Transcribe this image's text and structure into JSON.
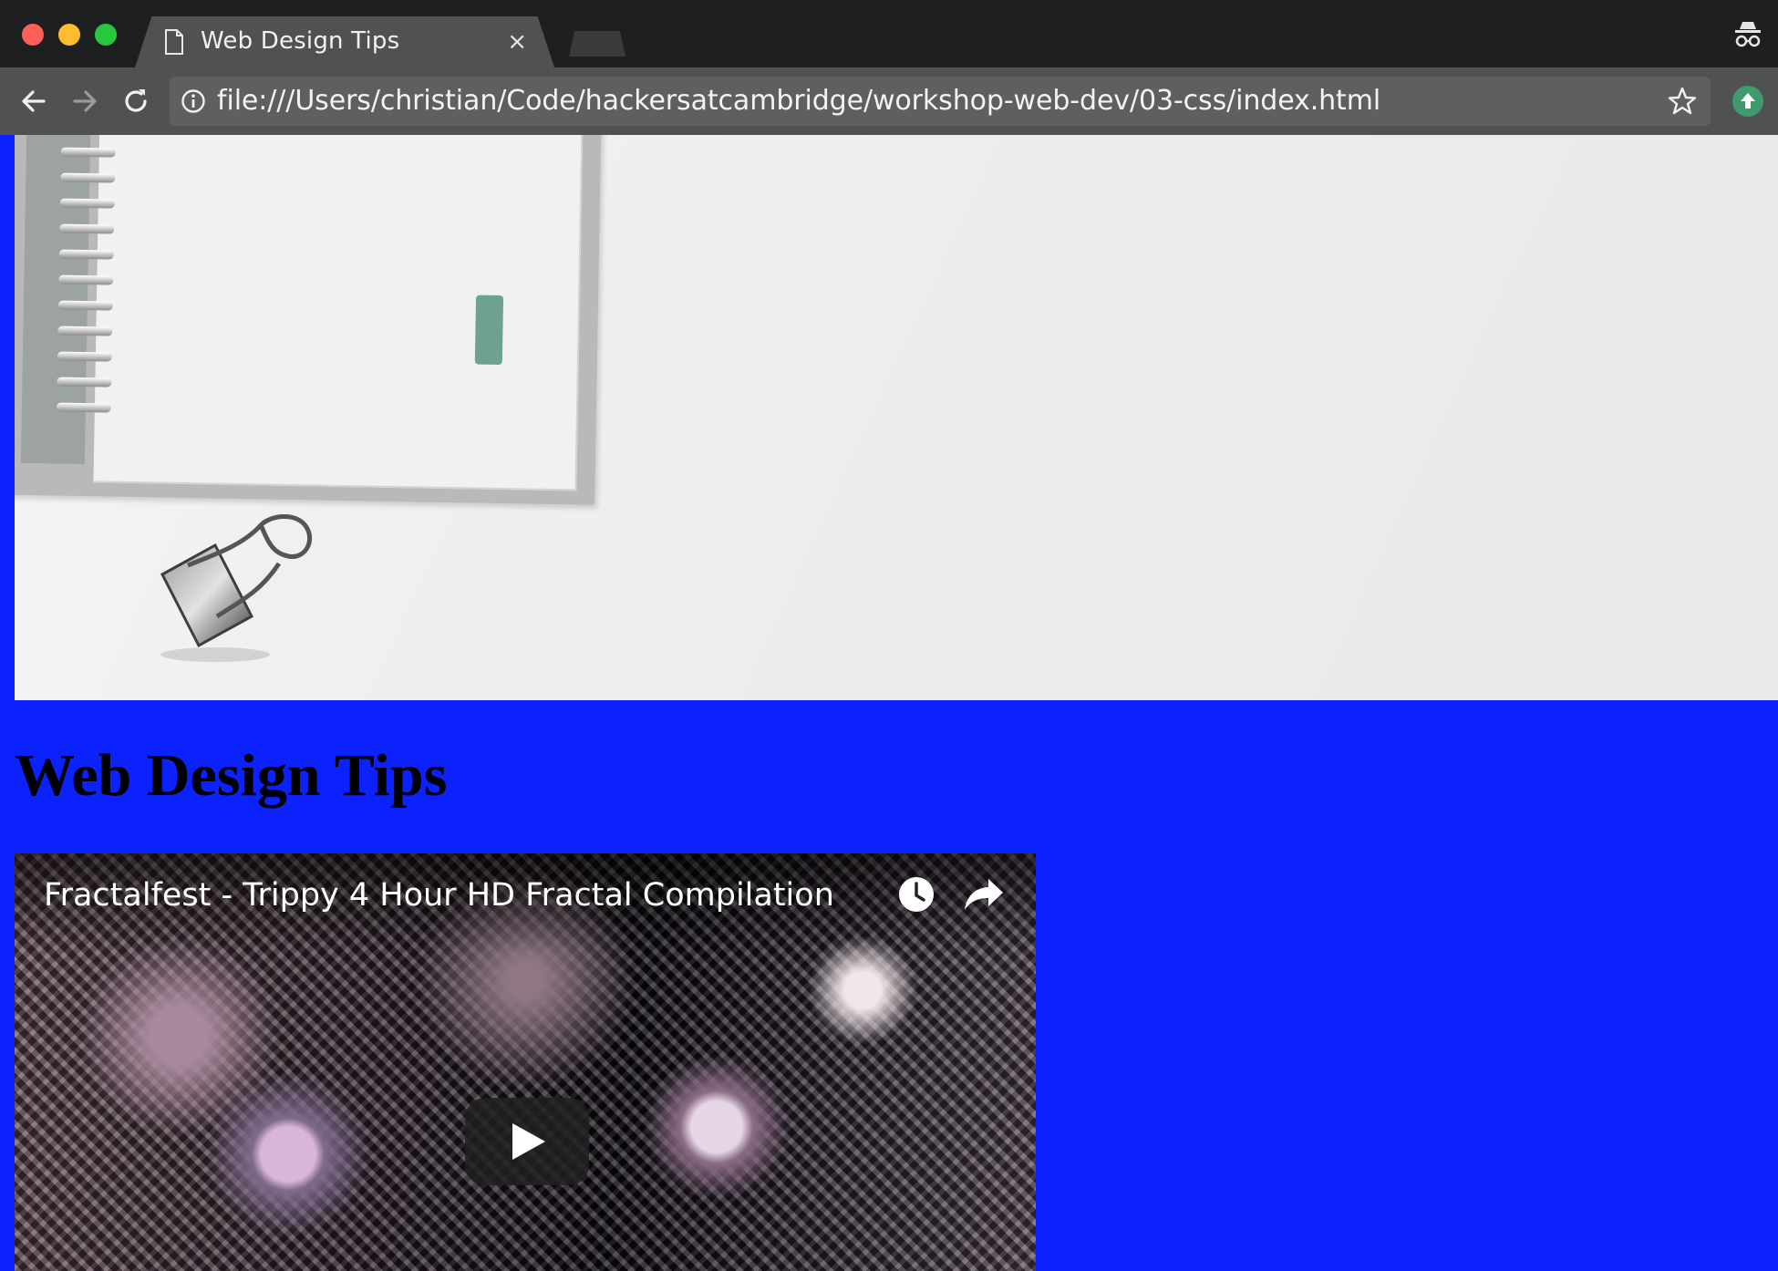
{
  "browser": {
    "tab": {
      "title": "Web Design Tips",
      "close_label": "×"
    },
    "address_bar": {
      "url": "file:///Users/christian/Code/hackersatcambridge/workshop-web-dev/03-css/index.html"
    },
    "icons": {
      "tab": "page-icon",
      "back": "back-arrow-icon",
      "forward": "forward-arrow-icon",
      "reload": "reload-icon",
      "info": "info-icon",
      "bookmark": "star-icon",
      "extension": "extension-icon",
      "incognito": "incognito-icon"
    }
  },
  "page": {
    "background_color": "#0c22fd",
    "heading": "Web Design Tips",
    "hero_image": "desk-notebook-binder-clip-photo",
    "video": {
      "title": "Fractalfest - Trippy 4 Hour HD Fractal Compilation",
      "icons": {
        "watch_later": "clock-icon",
        "share": "share-arrow-icon",
        "play": "play-icon"
      }
    }
  }
}
